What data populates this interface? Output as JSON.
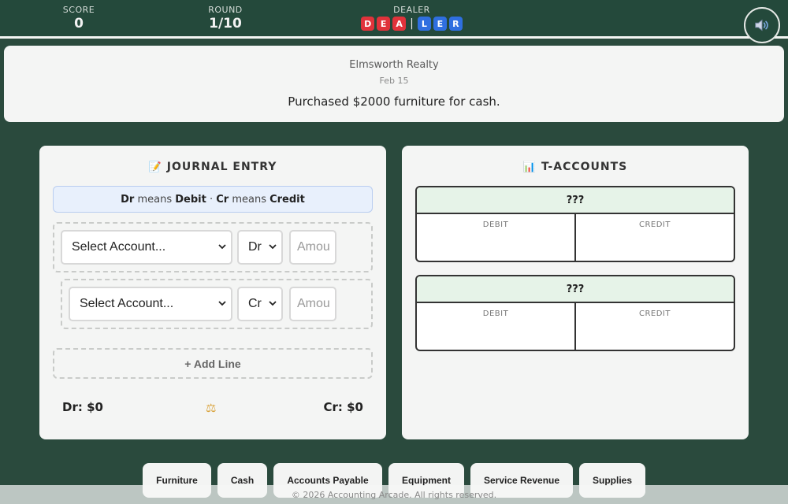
{
  "header": {
    "score_label": "SCORE",
    "score_value": "0",
    "round_label": "ROUND",
    "round_value": "1/10",
    "dealer_label": "DEALER",
    "dealer_tiles_red": [
      "D",
      "E",
      "A"
    ],
    "dealer_separator": "|",
    "dealer_tiles_blue": [
      "L",
      "E",
      "R"
    ],
    "sound_icon": "speaker-icon"
  },
  "scenario": {
    "company": "Elmsworth Realty",
    "date": "Feb 15",
    "description": "Purchased $2000 furniture for cash."
  },
  "journal": {
    "title_icon": "memo-icon",
    "title": "JOURNAL ENTRY",
    "hint": {
      "dr": "Dr",
      "means1": " means ",
      "debit": "Debit",
      "dot": " · ",
      "cr": "Cr",
      "means2": " means ",
      "credit": "Credit"
    },
    "lines": [
      {
        "account": "Select Account...",
        "side": "Dr",
        "amount_placeholder": "Amou"
      },
      {
        "account": "Select Account...",
        "side": "Cr",
        "amount_placeholder": "Amou"
      }
    ],
    "add_line_label": "+ Add Line",
    "dr_total": "Dr: $0",
    "cr_total": "Cr: $0",
    "balance_icon": "scale-icon"
  },
  "taccounts": {
    "title_icon": "bar-chart-icon",
    "title": "T-ACCOUNTS",
    "accounts": [
      {
        "name": "???",
        "debit_label": "DEBIT",
        "credit_label": "CREDIT"
      },
      {
        "name": "???",
        "debit_label": "DEBIT",
        "credit_label": "CREDIT"
      }
    ]
  },
  "account_chips": [
    "Furniture",
    "Cash",
    "Accounts Payable",
    "Equipment",
    "Service Revenue",
    "Supplies"
  ],
  "footer": "© 2026 Accounting Arcade. All rights reserved.",
  "colors": {
    "background": "#2a4a3d",
    "tile_red": "#e0333b",
    "tile_blue": "#2f6fe0",
    "t_header": "#e6f3e8"
  }
}
